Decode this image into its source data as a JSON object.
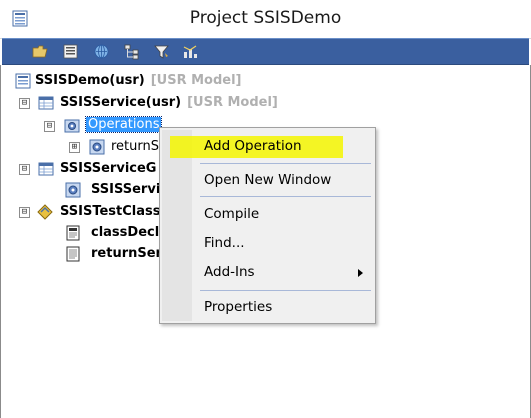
{
  "window": {
    "title": "Project SSISDemo"
  },
  "toolbar": {
    "buttons": [
      {
        "icon": "open-folder-icon"
      },
      {
        "icon": "properties-icon"
      },
      {
        "icon": "globe-icon"
      },
      {
        "icon": "hierarchy-icon"
      },
      {
        "icon": "filter-icon"
      },
      {
        "icon": "chart-icon"
      }
    ]
  },
  "tree": {
    "nodes": [
      {
        "label": "SSISDemo(usr)",
        "model": "[USR Model]"
      },
      {
        "label": "SSISService(usr)",
        "model": "[USR Model]"
      },
      {
        "label": "Operations"
      },
      {
        "label": "returnS"
      },
      {
        "label": "SSISServiceG"
      },
      {
        "label": "SSISServi"
      },
      {
        "label": "SSISTestClass"
      },
      {
        "label": "classDecla"
      },
      {
        "label": "returnSer"
      }
    ],
    "expander_minus": "⊟",
    "expander_plus": "⊞"
  },
  "context_menu": {
    "items": [
      {
        "label": "Add Operation"
      },
      {
        "label": "Open New Window"
      },
      {
        "label": "Compile"
      },
      {
        "label": "Find..."
      },
      {
        "label": "Add-Ins"
      },
      {
        "label": "Properties"
      }
    ]
  },
  "colors": {
    "toolbar": "#3a5f9f",
    "selection": "#3399ff",
    "highlight": "#f4f600"
  }
}
